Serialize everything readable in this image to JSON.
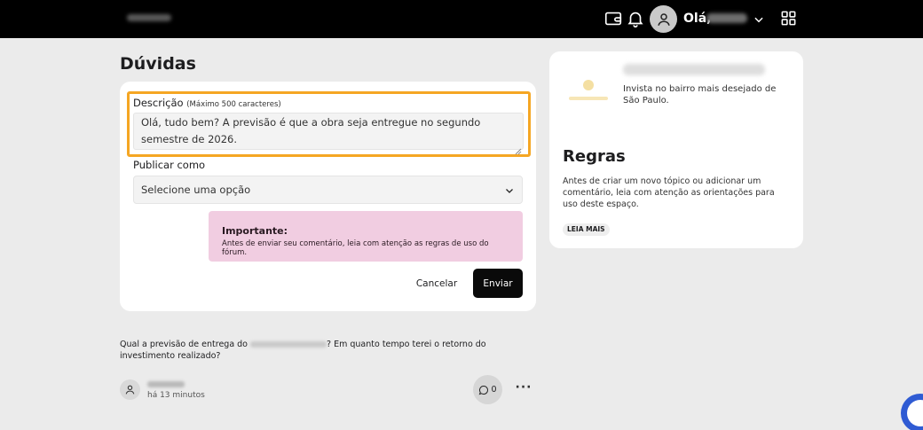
{
  "header": {
    "greeting": "Olá,"
  },
  "page": {
    "title": "Dúvidas"
  },
  "form": {
    "description_label": "Descrição",
    "description_hint": "(Máximo 500 caracteres)",
    "description_value": "Olá, tudo bem? A previsão é que a obra seja entregue no segundo semestre de 2026.\nOs pagamentos serão realizados anualmente, sempre no mês de janeiro. A\nrentabilidade prevista é de",
    "publish_label": "Publicar como",
    "publish_select_value": "Selecione uma opção",
    "important_title": "Importante:",
    "important_text": "Antes de enviar seu comentário, leia com atenção as regras de uso do fórum.",
    "cancel_label": "Cancelar",
    "send_label": "Enviar"
  },
  "question": {
    "text_before": "Qual a previsão de entrega do ",
    "text_after": "? Em quanto tempo terei o retorno do investimento realizado?",
    "time_ago": "há 13 minutos",
    "comment_count": "0",
    "more_label": "···"
  },
  "sidebar": {
    "condo_description": "Invista no bairro mais desejado de São Paulo.",
    "rules_title": "Regras",
    "rules_text": "Antes de criar um novo tópico ou adicionar um comentário, leia com atenção as orientações para uso deste espaço.",
    "read_more_label": "LEIA MAIS"
  },
  "colors": {
    "highlight": "#f5a623",
    "important_bg": "#f1cde1",
    "send_bg": "#0a0a0a",
    "chat_fab": "#2f5bd3"
  }
}
